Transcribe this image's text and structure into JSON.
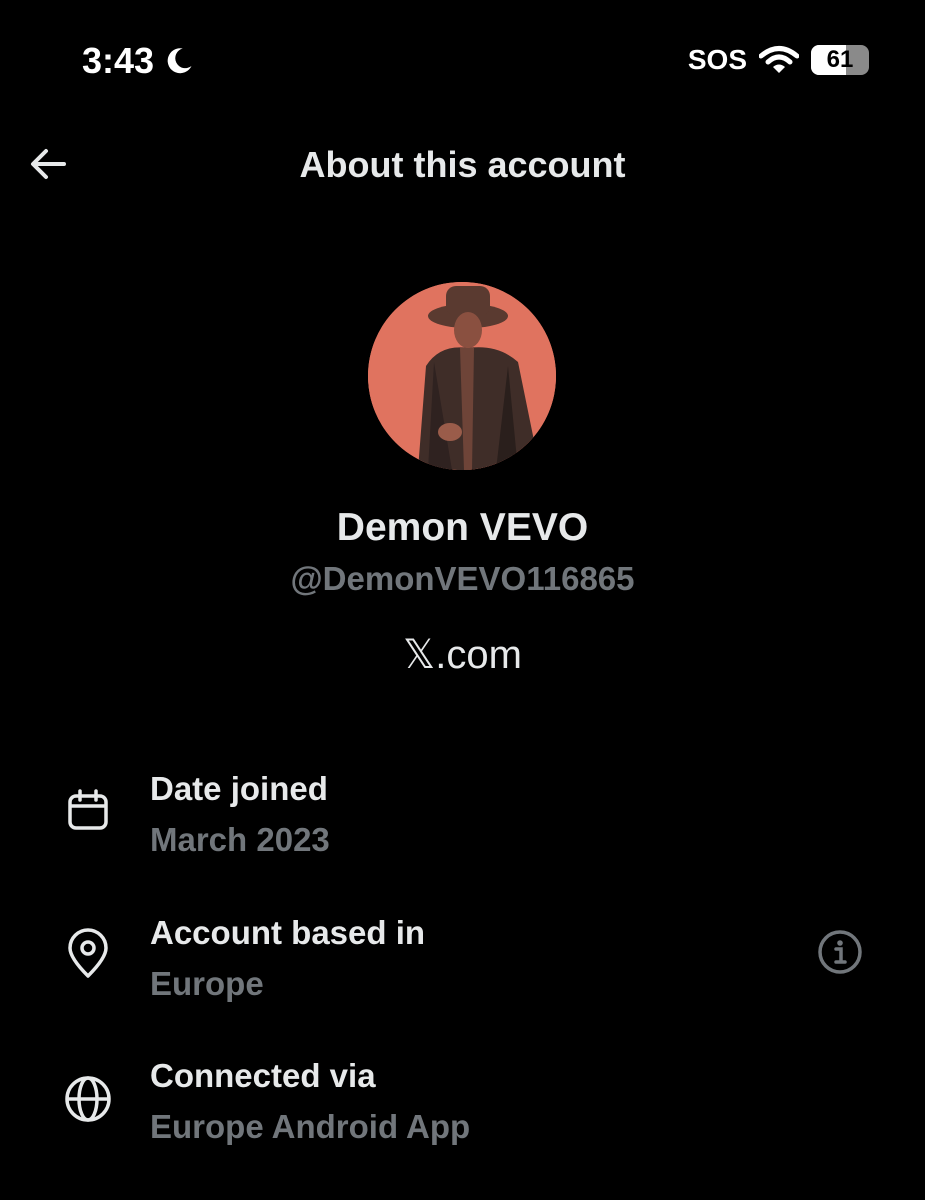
{
  "status_bar": {
    "time": "3:43",
    "carrier_text": "SOS",
    "battery_level": "61",
    "battery_fraction": 0.61,
    "icons": [
      "moon-icon",
      "wifi-icon",
      "battery-icon"
    ]
  },
  "header": {
    "title": "About this account",
    "back_icon": "back-arrow-icon"
  },
  "profile": {
    "display_name": "Demon VEVO",
    "handle": "@DemonVEVO116865",
    "site": "𝕏.com"
  },
  "details": [
    {
      "icon": "calendar-icon",
      "label": "Date joined",
      "value": "March 2023"
    },
    {
      "icon": "location-pin-icon",
      "label": "Account based in",
      "value": "Europe",
      "info_icon": "info-icon"
    },
    {
      "icon": "globe-icon",
      "label": "Connected via",
      "value": "Europe Android App"
    }
  ],
  "colors": {
    "background": "#000000",
    "primary_text": "#e7e9ea",
    "secondary_text": "#71767b",
    "avatar_tint": "#e0735f"
  }
}
